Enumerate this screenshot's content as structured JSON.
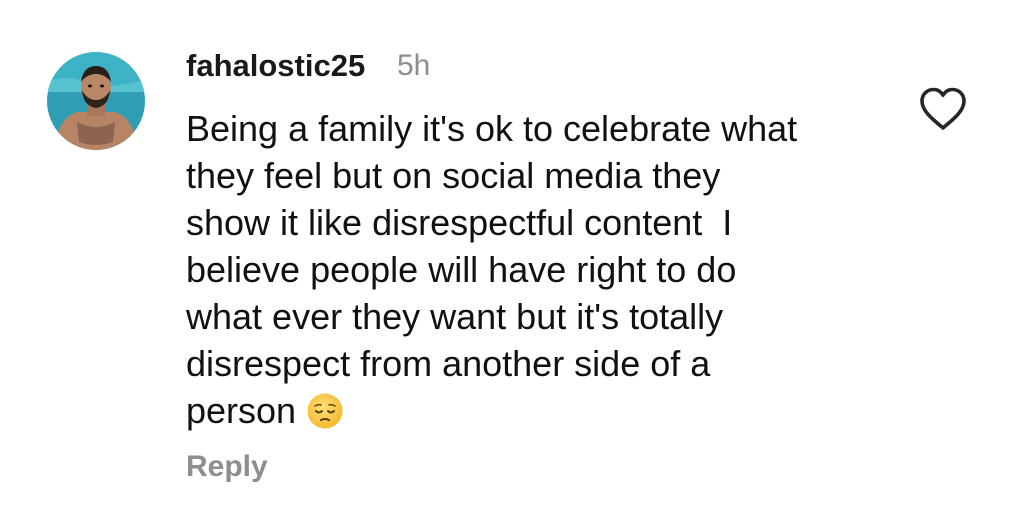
{
  "comment": {
    "username": "fahalostic25",
    "timestamp": "5h",
    "text_lines": [
      "Being a family it's ok to celebrate what",
      "they feel but on social media they",
      "show it like disrespectful content  I",
      "believe people will have right to do",
      "what ever they want but it's totally",
      "disrespect from another side of a",
      "person"
    ],
    "emoji": "pensive-face-emoji",
    "reply_label": "Reply",
    "like_icon": "heart-outline-icon"
  },
  "colors": {
    "text": "#111111",
    "muted": "#8e8e8e",
    "background": "#ffffff"
  }
}
